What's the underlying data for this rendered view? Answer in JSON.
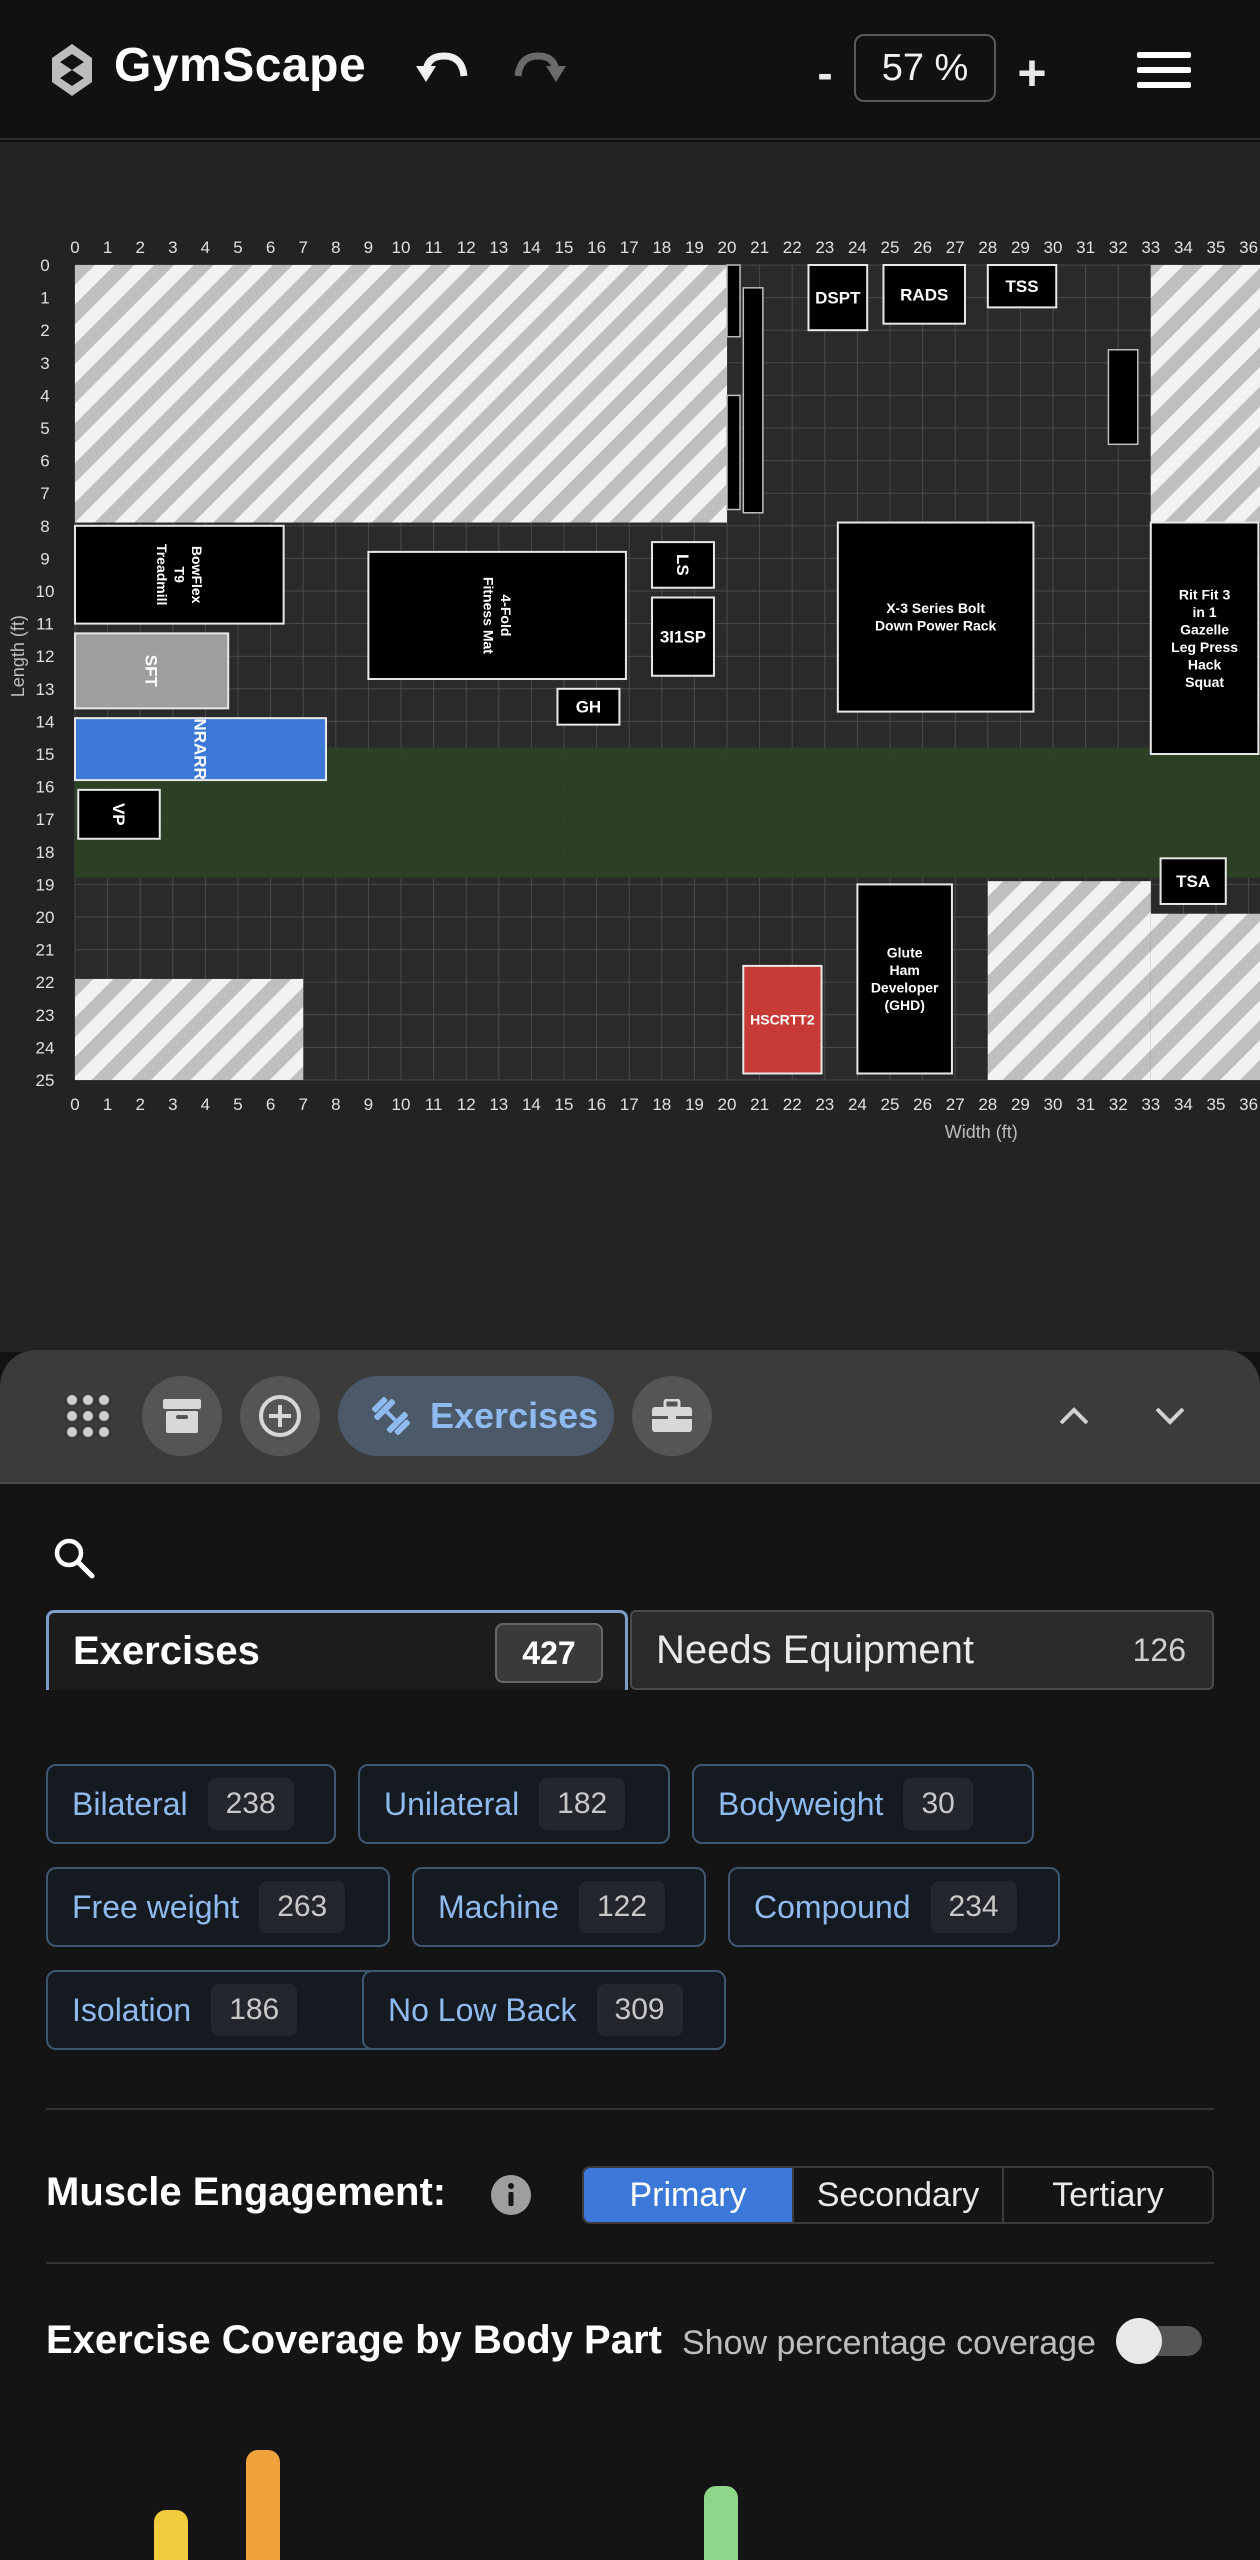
{
  "app": {
    "title": "GymScape"
  },
  "header": {
    "zoom_minus": "-",
    "zoom_value": "57 %",
    "zoom_plus": "+"
  },
  "plan": {
    "x_ticks": [
      "0",
      "1",
      "2",
      "3",
      "4",
      "5",
      "6",
      "7",
      "8",
      "9",
      "10",
      "11",
      "12",
      "13",
      "14",
      "15",
      "16",
      "17",
      "18",
      "19",
      "20",
      "21",
      "22",
      "23",
      "24",
      "25",
      "26",
      "27",
      "28",
      "29",
      "30",
      "31",
      "32",
      "33",
      "34",
      "35",
      "36"
    ],
    "y_ticks": [
      "0",
      "1",
      "2",
      "3",
      "4",
      "5",
      "6",
      "7",
      "8",
      "9",
      "10",
      "11",
      "12",
      "13",
      "14",
      "15",
      "16",
      "17",
      "18",
      "19",
      "20",
      "21",
      "22",
      "23",
      "24",
      "25"
    ],
    "x_label": "Width (ft)",
    "y_label": "Length (ft)",
    "equipment": [
      {
        "label": "DSPT",
        "x": 22.5,
        "y": 0,
        "w": 1.8,
        "h": 2,
        "color": "#000000"
      },
      {
        "label": "RADS",
        "x": 24.8,
        "y": 0,
        "w": 2.5,
        "h": 1.8,
        "color": "#000000"
      },
      {
        "label": "TSS",
        "x": 28,
        "y": 0,
        "w": 2.1,
        "h": 1.3,
        "color": "#000000"
      },
      {
        "label": "BowFlex T9 Treadmill",
        "x": 0,
        "y": 8,
        "w": 6.4,
        "h": 3,
        "color": "#000000",
        "rot": true
      },
      {
        "label": "4-Fold Fitness Mat",
        "x": 9,
        "y": 8.8,
        "w": 7.9,
        "h": 3.9,
        "color": "#000000",
        "rot": true
      },
      {
        "label": "LS",
        "x": 17.7,
        "y": 8.5,
        "w": 1.9,
        "h": 1.4,
        "color": "#000000",
        "rot": true
      },
      {
        "label": "3I1SP",
        "x": 17.7,
        "y": 10.2,
        "w": 1.9,
        "h": 2.4,
        "color": "#000000"
      },
      {
        "label": "X-3 Series Bolt Down Power Rack",
        "x": 23.4,
        "y": 7.9,
        "w": 6,
        "h": 5.8,
        "color": "#000000"
      },
      {
        "label": "Rit Fit 3 in 1 Gazelle Leg Press Hack Squat",
        "x": 33,
        "y": 7.9,
        "w": 3.3,
        "h": 7.1,
        "color": "#000000"
      },
      {
        "label": "SFT",
        "x": 0,
        "y": 11.3,
        "w": 4.7,
        "h": 2.3,
        "color": "#9e9e9e",
        "rot": true
      },
      {
        "label": "GH",
        "x": 14.8,
        "y": 13,
        "w": 1.9,
        "h": 1.1,
        "color": "#000000"
      },
      {
        "label": "NRARR",
        "x": 0,
        "y": 13.9,
        "w": 7.7,
        "h": 1.9,
        "color": "#3b78d8",
        "rot": true
      },
      {
        "label": "VP",
        "x": 0.1,
        "y": 16.1,
        "w": 2.5,
        "h": 1.5,
        "color": "#000000",
        "rot": true
      },
      {
        "label": "TSA",
        "x": 33.3,
        "y": 18.2,
        "w": 2,
        "h": 1.4,
        "color": "#000000"
      },
      {
        "label": "Glute Ham Developer (GHD)",
        "x": 24,
        "y": 19,
        "w": 2.9,
        "h": 5.8,
        "color": "#000000"
      },
      {
        "label": "HSCRTT2",
        "x": 20.5,
        "y": 21.5,
        "w": 2.4,
        "h": 3.3,
        "color": "#c73a35"
      }
    ]
  },
  "panel": {
    "toolbar": {
      "exercises_label": "Exercises"
    },
    "tabs": {
      "exercises_label": "Exercises",
      "exercises_count": "427",
      "needs_label": "Needs Equipment",
      "needs_count": "126"
    },
    "filters": [
      {
        "label": "Bilateral",
        "count": "238"
      },
      {
        "label": "Unilateral",
        "count": "182"
      },
      {
        "label": "Bodyweight",
        "count": "30"
      },
      {
        "label": "Free weight",
        "count": "263"
      },
      {
        "label": "Machine",
        "count": "122"
      },
      {
        "label": "Compound",
        "count": "234"
      },
      {
        "label": "Isolation",
        "count": "186"
      },
      {
        "label": "No Low Back",
        "count": "309"
      }
    ],
    "muscle": {
      "title": "Muscle Engagement:",
      "options": [
        "Primary",
        "Secondary",
        "Tertiary"
      ],
      "selected": "Primary"
    },
    "coverage": {
      "title": "Exercise Coverage by Body Part",
      "toggle_label": "Show percentage coverage",
      "toggle_on": false
    }
  },
  "colors": {
    "accent": "#3b78d8",
    "chip_text": "#8fbaf0",
    "zone_green": "#2c4226",
    "hatch": "#c8c8c8",
    "bar_yellow": "#f0cc3c",
    "bar_orange": "#f0a23c",
    "bar_green": "#8fd68a"
  }
}
